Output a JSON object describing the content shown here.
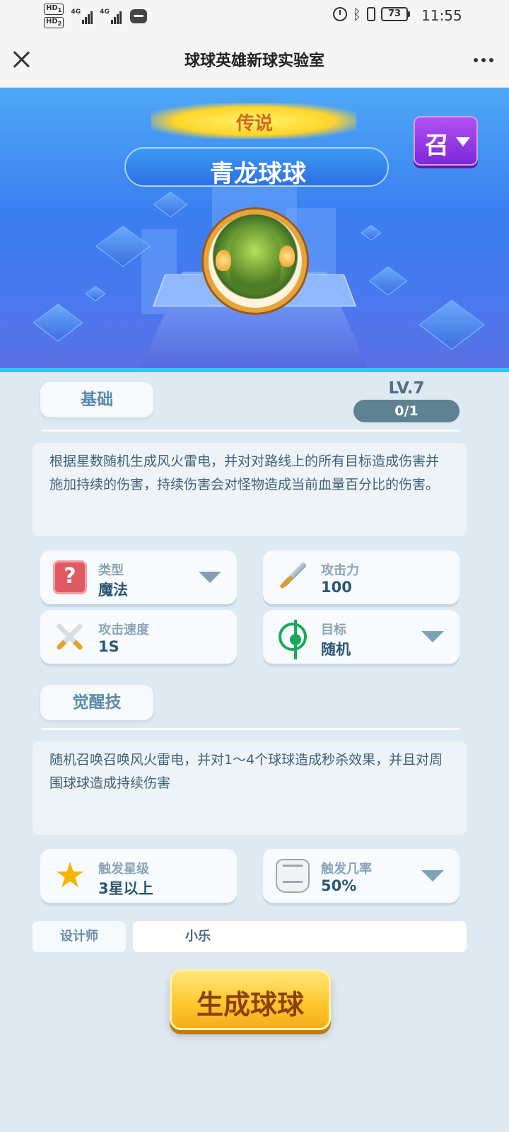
{
  "status_bar": {
    "sim1": "HD",
    "sim1_num": "1",
    "sim2": "HD",
    "sim2_num": "2",
    "net1": "4G",
    "net2": "4G",
    "battery": "73",
    "time": "11:55"
  },
  "header": {
    "title": "球球英雄新球实验室",
    "close_icon": "close-icon",
    "more_icon": "more-icon"
  },
  "hero": {
    "rarity": "传说",
    "name": "青龙球球",
    "summon_label": "召",
    "portrait": "dragon-portrait"
  },
  "basic": {
    "tab_label": "基础",
    "level": "LV.7",
    "progress_text": "0/1",
    "progress_fraction": 0,
    "description": "根据星数随机生成风火雷电，并对对路线上的所有目标造成伤害并施加持续的伤害，持续伤害会对怪物造成当前血量百分比的伤害。",
    "stats": [
      {
        "label": "类型",
        "value": "魔法",
        "icon": "question-icon",
        "dropdown": true
      },
      {
        "label": "攻击力",
        "value": "100",
        "icon": "sword-icon",
        "dropdown": false
      },
      {
        "label": "攻击速度",
        "value": "1S",
        "icon": "crossed-swords-icon",
        "dropdown": false
      },
      {
        "label": "目标",
        "value": "随机",
        "icon": "target-icon",
        "dropdown": true
      }
    ]
  },
  "awaken": {
    "tab_label": "觉醒技",
    "description": "随机召唤召唤风火雷电，并对1～4个球球造成秒杀效果，并且对周围球球造成持续伤害",
    "stats": [
      {
        "label": "触发星级",
        "value": "3星以上",
        "icon": "star-icon",
        "dropdown": false
      },
      {
        "label": "触发几率",
        "value": "50%",
        "icon": "glove-icon",
        "dropdown": true
      }
    ]
  },
  "designer": {
    "label": "设计师",
    "value": "小乐"
  },
  "generate_button": "生成球球",
  "colors": {
    "hero_blue": "#3a7ef0",
    "summon_purple": "#9b3ee6",
    "button_yellow": "#ffc52b",
    "text_dark": "#2f5672"
  }
}
